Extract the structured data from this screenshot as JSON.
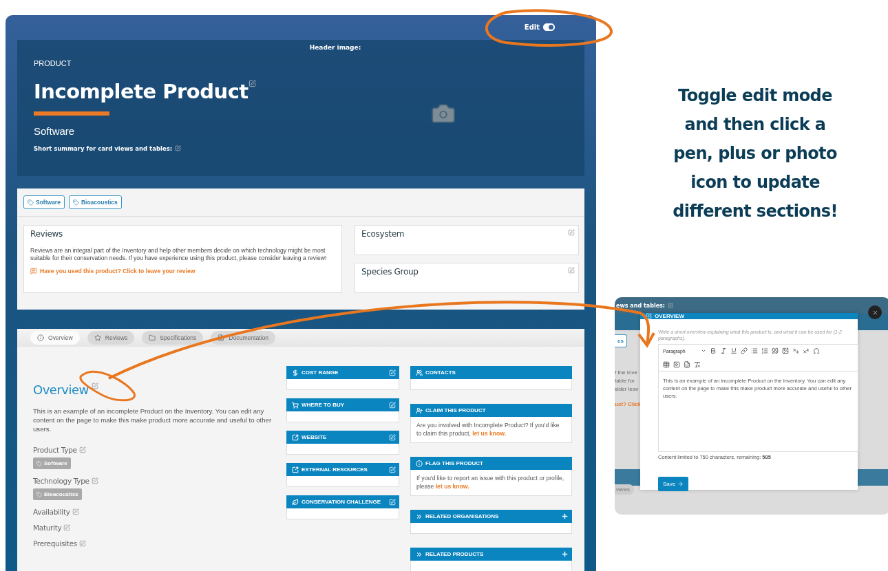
{
  "callout": {
    "text": "Toggle edit mode and then click a pen, plus or photo icon to update different sections!"
  },
  "page": {
    "edit_toggle": {
      "label": "Edit",
      "on": true
    },
    "header": {
      "image_label": "Header image:",
      "eyebrow": "PRODUCT",
      "title": "Incomplete Product",
      "subtitle": "Software",
      "summary_label": "Short summary for card views and tables:"
    },
    "tags": [
      {
        "label": "Software"
      },
      {
        "label": "Bioacoustics"
      }
    ],
    "reviews": {
      "title": "Reviews",
      "body": "Reviews are an integral part of the Inventory and help other members decide on which technology might be most suitable for their conservation needs. If you have experience using this product, please consider leaving a review!",
      "link": "Have you used this product? Click to leave your review"
    },
    "side_cards": [
      {
        "title": "Ecosystem"
      },
      {
        "title": "Species Group"
      }
    ],
    "tabs": [
      {
        "label": "Overview",
        "selected": true
      },
      {
        "label": "Reviews",
        "selected": false
      },
      {
        "label": "Specifications",
        "selected": false
      },
      {
        "label": "Documentation",
        "selected": false
      }
    ],
    "overview": {
      "heading": "Overview",
      "body": "This is an example of an incomplete Product on the Inventory. You can edit any content on the page to make this make product more accurate and useful to other users.",
      "fields": [
        {
          "label": "Product Type",
          "tag": "Software"
        },
        {
          "label": "Technology Type",
          "tag": "Bioacoustics"
        },
        {
          "label": "Availability"
        },
        {
          "label": "Maturity"
        },
        {
          "label": "Prerequisites"
        }
      ]
    },
    "widgets": [
      {
        "title": "COST RANGE"
      },
      {
        "title": "WHERE TO BUY"
      },
      {
        "title": "WEBSITE"
      },
      {
        "title": "EXTERNAL RESOURCES"
      },
      {
        "title": "CONSERVATION CHALLENGE"
      }
    ],
    "panels": [
      {
        "title": "CONTACTS",
        "addable": false
      },
      {
        "title": "CLAIM THIS PRODUCT",
        "addable": false,
        "body": "Are you involved with Incomplete Product? If you'd like to claim this product,",
        "link": "let us know."
      },
      {
        "title": "FLAG THIS PRODUCT",
        "addable": false,
        "body": "If you'd like to report an issue with this product or profile, please",
        "link": "let us know."
      },
      {
        "title": "RELATED ORGANISATIONS",
        "addable": true
      },
      {
        "title": "RELATED PRODUCTS",
        "addable": true
      }
    ]
  },
  "editor_inset": {
    "backdrop": {
      "summary_fragment": "ews and tables:",
      "tag_fragment": "cs",
      "text_fragments": [
        "f the Inve",
        "table for",
        "sider leav"
      ],
      "link_fragment": "uct? Click",
      "tab_fragment": "views"
    },
    "modal": {
      "title": "OVERVIEW",
      "hint": "Write a short overview explaining what this product is, and what it can be used for (1-2 paragraphs).",
      "block_style": "Paragraph",
      "content": "This is an example of an incomplete Product on the Inventory. You can edit any content on the page to make this make product more accurate and useful to other users.",
      "limit_text": "Content limited to 750 characters, remaining: **585**",
      "save": "Save"
    }
  }
}
